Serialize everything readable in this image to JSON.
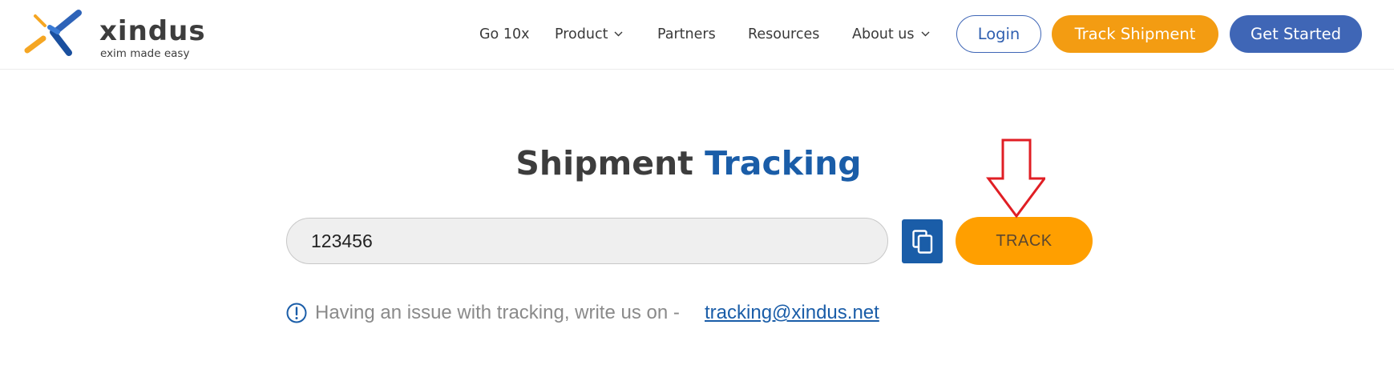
{
  "brand": {
    "name": "xindus",
    "tagline": "exim made easy",
    "colors": {
      "orange": "#f39c12",
      "blue": "#1a5da8",
      "navy": "#3f66b6"
    }
  },
  "nav": {
    "items": [
      {
        "label": "Go 10x",
        "dropdown": false
      },
      {
        "label": "Product",
        "dropdown": true
      },
      {
        "label": "Partners",
        "dropdown": false
      },
      {
        "label": "Resources",
        "dropdown": false
      },
      {
        "label": "About us",
        "dropdown": true
      }
    ],
    "login_label": "Login",
    "track_shipment_label": "Track Shipment",
    "get_started_label": "Get Started"
  },
  "main": {
    "title_part1": "Shipment",
    "title_part2": "Tracking",
    "tracking_input_value": "123456",
    "copy_icon": "copy-icon",
    "track_button_label": "TRACK",
    "annotation_icon": "red-down-arrow-icon",
    "help_icon": "info-circle-icon",
    "help_text": "Having an issue with tracking, write us on -",
    "help_email": "tracking@xindus.net"
  }
}
